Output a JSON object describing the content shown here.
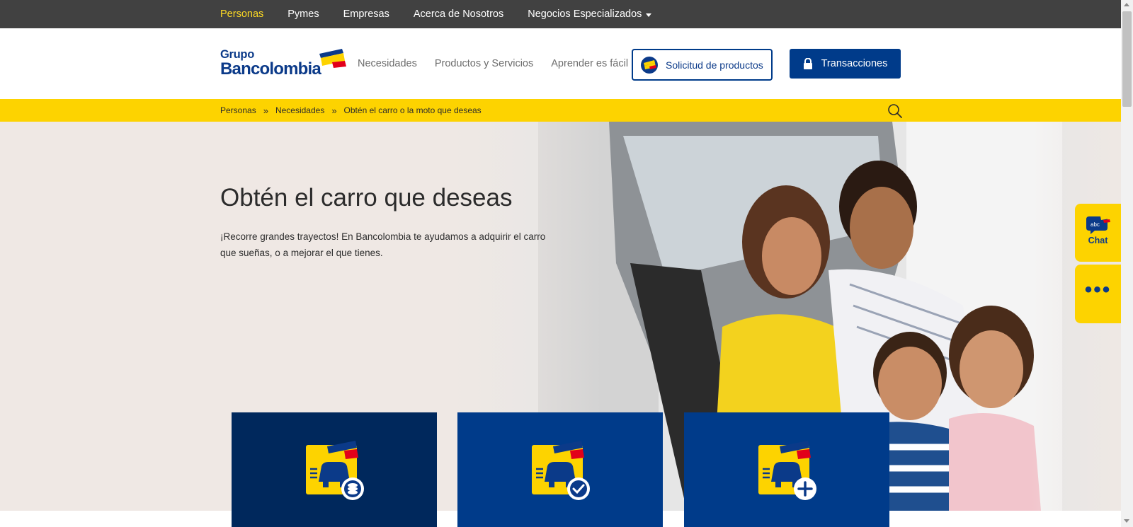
{
  "topnav": {
    "items": [
      {
        "label": "Personas",
        "active": true
      },
      {
        "label": "Pymes"
      },
      {
        "label": "Empresas"
      },
      {
        "label": "Acerca de Nosotros"
      },
      {
        "label": "Negocios Especializados",
        "has_dropdown": true
      }
    ]
  },
  "logo": {
    "line1": "Grupo",
    "line2": "Bancolombia"
  },
  "mainnav": {
    "items": [
      {
        "label": "Necesidades"
      },
      {
        "label": "Productos y Servicios"
      },
      {
        "label": "Aprender es fácil"
      }
    ],
    "solicitud_label": "Solicitud de productos",
    "transacciones_label": "Transacciones"
  },
  "breadcrumb": {
    "items": [
      "Personas",
      "Necesidades",
      "Obtén el carro o la moto que deseas"
    ],
    "separator": "»"
  },
  "hero": {
    "title": "Obtén el carro que deseas",
    "description": "¡Recorre grandes trayectos! En Bancolombia te ayudamos a adquirir el carro que sueñas, o a mejorar el que tienes."
  },
  "cards": [
    {
      "icon": "car-coins-icon"
    },
    {
      "icon": "car-check-icon"
    },
    {
      "icon": "car-plus-icon"
    }
  ],
  "widgets": {
    "chat_label": "Chat",
    "chat_badge": "abc",
    "more_label": "•••"
  },
  "colors": {
    "brand_blue": "#003b8a",
    "brand_yellow": "#fdd300",
    "topbar": "#414141",
    "active_nav": "#fdda24",
    "hero_bg": "#efe8e4"
  }
}
